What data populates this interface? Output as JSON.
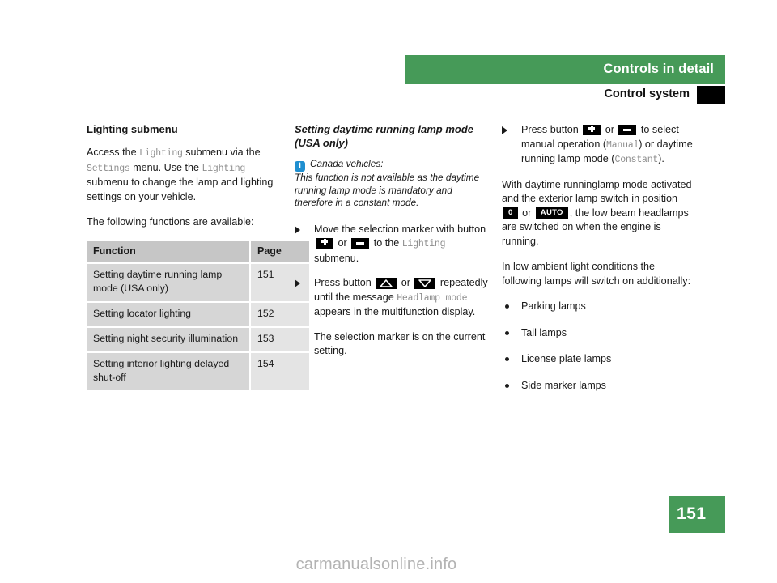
{
  "header": {
    "band_title": "Controls in detail",
    "sub_title": "Control system"
  },
  "left_column": {
    "heading": "Lighting submenu",
    "para1_part1": "Access the ",
    "para1_mono1": "Lighting",
    "para1_part2": " submenu via the ",
    "para1_mono2": "Settings",
    "para1_part3": " menu. Use the ",
    "para1_mono3": "Lighting",
    "para1_part4": " submenu to change the lamp and lighting settings on your vehicle.",
    "para2": "The following functions are available:",
    "table": {
      "headers": [
        "Function",
        "Page"
      ],
      "rows": [
        {
          "function": "Setting daytime running lamp mode (USA only)",
          "page": "151"
        },
        {
          "function": "Setting locator lighting",
          "page": "152"
        },
        {
          "function": "Setting night security illumination",
          "page": "153"
        },
        {
          "function": "Setting interior lighting delayed shut-off",
          "page": "154"
        }
      ]
    }
  },
  "middle_column": {
    "heading": "Setting daytime running lamp mode (USA only)",
    "note_label": "Canada vehicles:",
    "note_body": "This function is not available as the daytime running lamp mode is mandatory and therefore in a constant mode.",
    "step1_part1": "Move the selection marker with button ",
    "step1_or": " or ",
    "step1_part2": " to the ",
    "step1_mono": "Lighting",
    "step1_part3": " submenu.",
    "step2_part1": "Press button ",
    "step2_or": " or ",
    "step2_part2": " repeatedly until the message ",
    "step2_mono": "Headlamp mode",
    "step2_part3": " appears in the multifunction display.",
    "step2_sub": "The selection marker is on the current setting."
  },
  "right_column": {
    "step1_part1": "Press button ",
    "step1_or": " or ",
    "step1_part2": " to select manual operation (",
    "step1_mono1": "Manual",
    "step1_part3": ") or daytime running lamp mode (",
    "step1_mono2": "Constant",
    "step1_part4": ").",
    "para1_part1": "With daytime runninglamp mode activated and the exterior lamp switch in position ",
    "para1_or": " or ",
    "para1_part2": ", the low beam headlamps are switched on when the engine is running.",
    "para2": "In low ambient light conditions the following lamps will switch on additionally:",
    "lamps": [
      "Parking lamps",
      "Tail lamps",
      "License plate lamps",
      "Side marker lamps"
    ]
  },
  "keys": {
    "plus": "plus-button",
    "minus": "minus-button",
    "up": "up-arrow-button",
    "down": "down-arrow-button",
    "zero": "0",
    "auto": "AUTO"
  },
  "footer": {
    "page_number": "151",
    "watermark": "carmanualsonline.info"
  },
  "colors": {
    "brand_green": "#469a58",
    "info_blue": "#1f8fd0",
    "mono_gray": "#8d8d8d",
    "table_header": "#c6c6c6",
    "table_fn_cell": "#d6d6d6",
    "table_pg_cell": "#e4e4e4"
  }
}
